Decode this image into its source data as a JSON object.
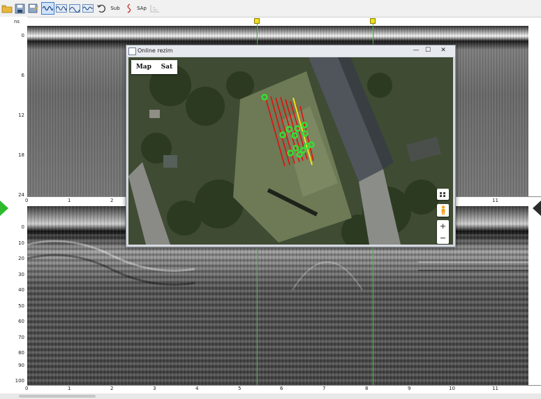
{
  "toolbar": {
    "buttons": [
      {
        "name": "open-folder-icon",
        "glyph": "📂"
      },
      {
        "name": "save-icon",
        "glyph": "💾"
      },
      {
        "name": "save-as-icon",
        "glyph": "🖫"
      },
      {
        "name": "wave-view-1-icon",
        "glyph": "∿",
        "selected": true
      },
      {
        "name": "wave-view-2-icon",
        "glyph": "∿"
      },
      {
        "name": "wave-view-3-icon",
        "glyph": "∿"
      },
      {
        "name": "wave-view-4-icon",
        "glyph": "∿"
      },
      {
        "name": "undo-icon",
        "glyph": "↶"
      }
    ],
    "sub_label": "Sub",
    "sap_label": "SAp"
  },
  "upper_panel": {
    "unit": "ns",
    "y_ticks": [
      "0",
      "6",
      "12",
      "18",
      "24"
    ],
    "x_ticks": [
      "0",
      "1",
      "2",
      "11"
    ]
  },
  "lower_panel": {
    "y_ticks": [
      "0",
      "10",
      "20",
      "30",
      "40",
      "50",
      "60",
      "70",
      "80",
      "90",
      "100"
    ],
    "x_ticks": [
      "0",
      "1",
      "2",
      "3",
      "4",
      "5",
      "6",
      "7",
      "8",
      "9",
      "10",
      "11"
    ]
  },
  "online_window": {
    "title": "Online rezim",
    "minimize_glyph": "—",
    "maximize_glyph": "☐",
    "close_glyph": "✕",
    "map_type": {
      "map_label": "Map",
      "sat_label": "Sat"
    },
    "zoom_in": "+",
    "zoom_out": "−"
  },
  "colors": {
    "accent_green": "#37c837",
    "track_red": "#e01010",
    "track_yellow": "#f4e21a",
    "marker_yellow": "#f0e020"
  }
}
